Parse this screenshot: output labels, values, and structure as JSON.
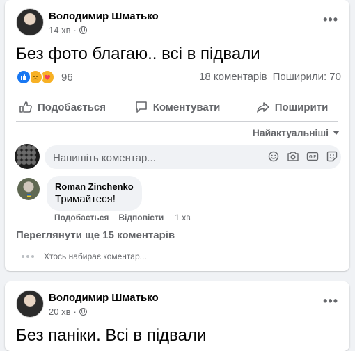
{
  "posts": [
    {
      "author": "Володимир Шматько",
      "time": "14 хв",
      "text": "Без фото благаю.. всі в підвали",
      "reaction_count": "96",
      "comments_count": "18 коментарів",
      "shares": "Поширили: 70",
      "actions": {
        "like": "Подобається",
        "comment": "Коментувати",
        "share": "Поширити"
      },
      "sort_label": "Найактуальніші",
      "composer_placeholder": "Напишіть коментар...",
      "comments": [
        {
          "author": "Roman Zinchenko",
          "text": "Тримайтеся!",
          "like_label": "Подобається",
          "reply_label": "Відповісти",
          "time": "1 хв"
        }
      ],
      "view_more_comments": "Переглянути ще 15 коментарів",
      "typing_indicator": "Хтось набирає коментар..."
    },
    {
      "author": "Володимир Шматько",
      "time": "20 хв",
      "text": "Без паніки. Всі в підвали"
    }
  ],
  "icons": {
    "reactions": [
      "like-reaction-icon",
      "sad-reaction-icon",
      "care-reaction-icon"
    ],
    "composer": [
      "emoji-icon",
      "camera-icon",
      "gif-icon",
      "sticker-icon"
    ]
  },
  "colors": {
    "link_blue": "#1877f2",
    "secondary_text": "#65676b",
    "background": "#f0f2f5"
  }
}
